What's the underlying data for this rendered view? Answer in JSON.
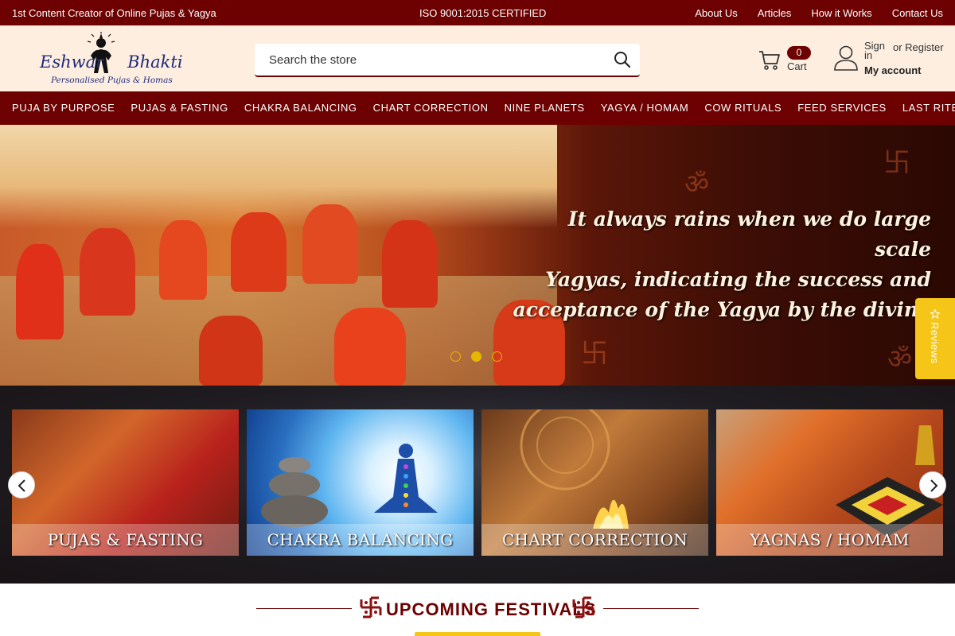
{
  "topbar": {
    "tagline": "1st Content Creator of Online Pujas & Yagya",
    "iso": "ISO 9001:2015 CERTIFIED",
    "links": [
      "About Us",
      "Articles",
      "How it Works",
      "Contact Us"
    ]
  },
  "header": {
    "logo": {
      "brand_left": "Eshwar",
      "brand_right": "Bhakti",
      "tagline": "Personalised Pujas & Homas"
    },
    "search": {
      "placeholder": "Search the store"
    },
    "cart": {
      "count": "0",
      "label": "Cart"
    },
    "account": {
      "sign_in": "Sign in",
      "register": "or Register",
      "my_account": "My account"
    }
  },
  "nav": {
    "items": [
      "PUJA BY PURPOSE",
      "PUJAS & FASTING",
      "CHAKRA BALANCING",
      "CHART CORRECTION",
      "NINE PLANETS",
      "YAGYA / HOMAM",
      "COW RITUALS",
      "FEED SERVICES",
      "LAST RITES"
    ]
  },
  "hero": {
    "quote_lines": [
      "It always rains when we do large scale",
      "Yagyas, indicating the success and",
      "acceptance of  the Yagya by the divine"
    ],
    "slide_count": 3,
    "active_slide": 2
  },
  "reviews": {
    "label": "Reviews"
  },
  "categories": {
    "cards": [
      {
        "caption": "PUJAS & FASTING"
      },
      {
        "caption": "CHAKRA BALANCING"
      },
      {
        "caption": "CHART CORRECTION"
      },
      {
        "caption": "YAGNAS / HOMAM"
      }
    ]
  },
  "festivals": {
    "title": "UPCOMING FESTIVALS"
  },
  "colors": {
    "maroon": "#6d0000",
    "header_bg": "#fdeee0",
    "accent_yellow": "#f5c518"
  },
  "icons": [
    "search-icon",
    "cart-icon",
    "user-icon",
    "star-icon",
    "chevron-left-icon",
    "chevron-right-icon",
    "swastika-icon"
  ]
}
